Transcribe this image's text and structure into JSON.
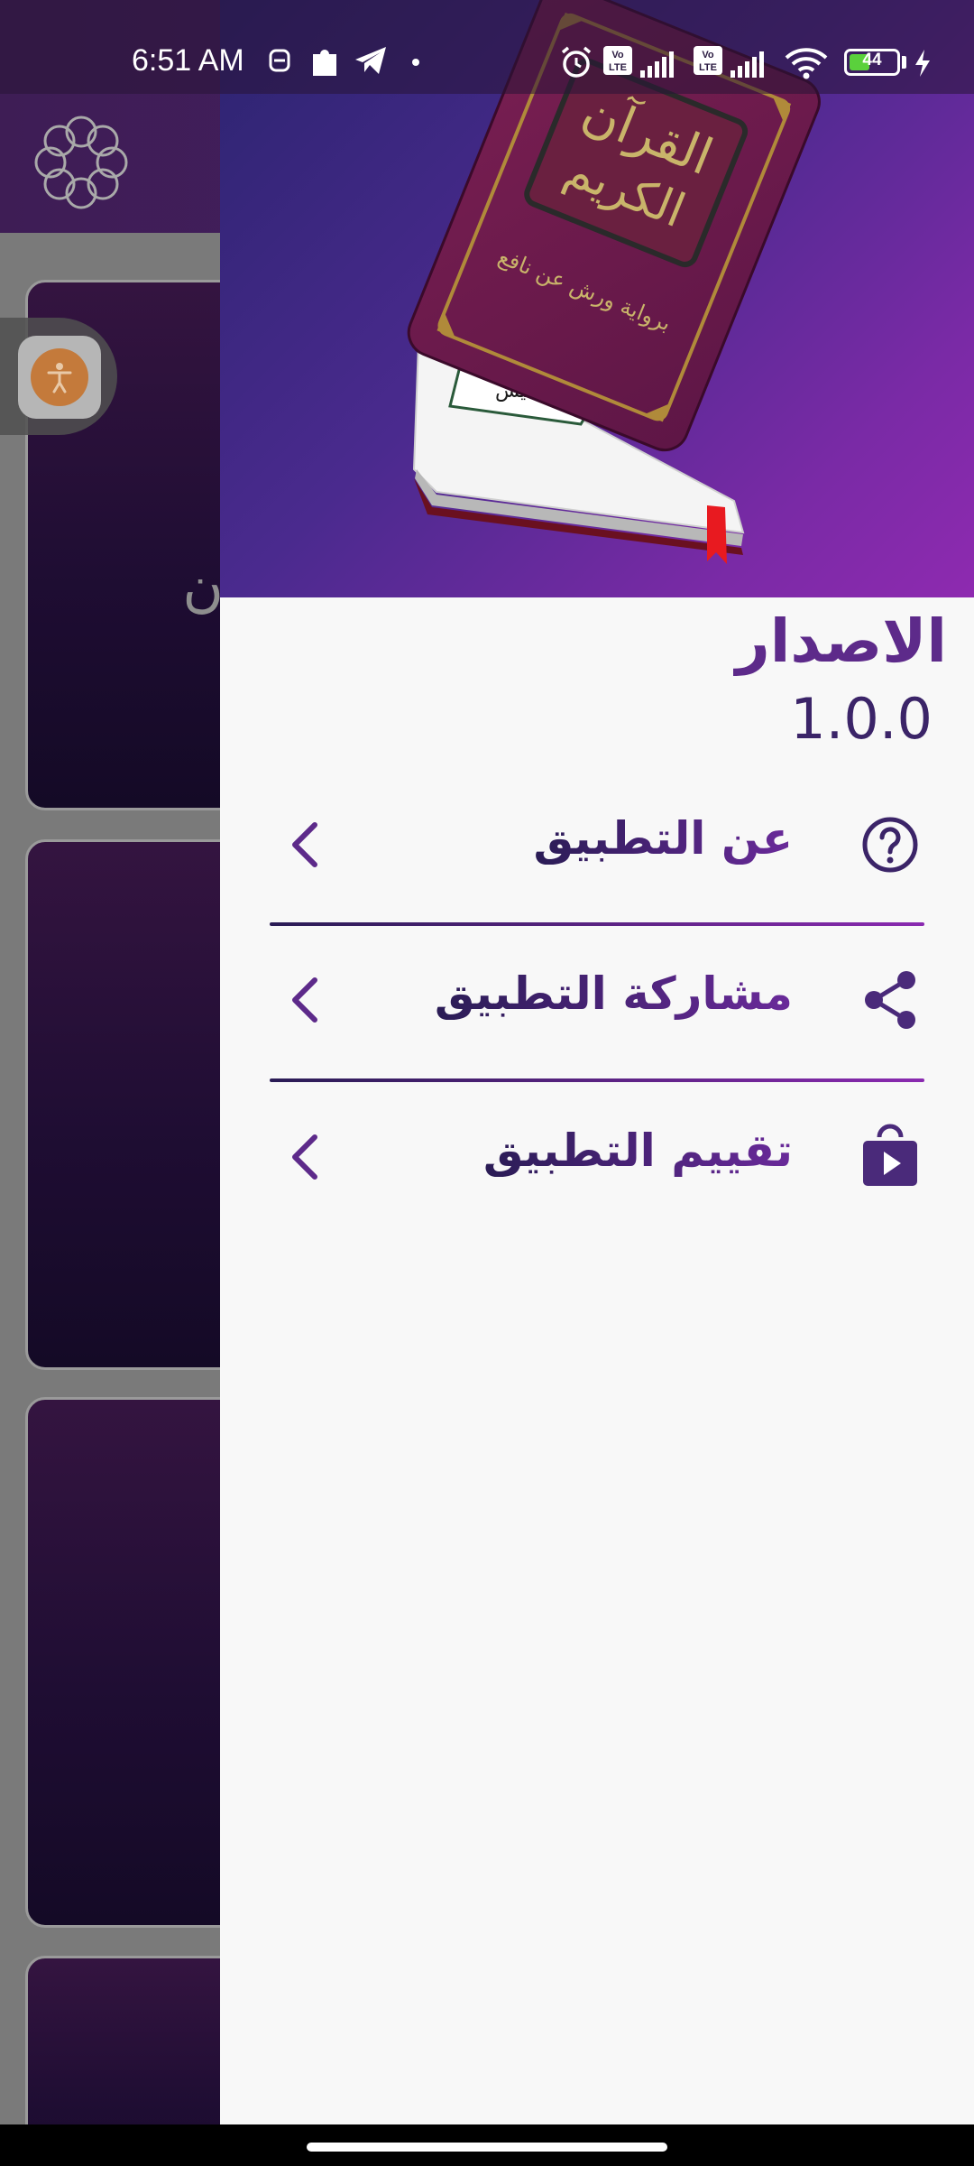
{
  "status_bar": {
    "time": "6:51 AM",
    "battery_level": "44",
    "battery_fraction": 0.44,
    "icons": [
      "notification-icon",
      "puzzle-icon",
      "telegram-icon",
      "dot-icon",
      "alarm-icon",
      "volte-icon",
      "signal-icon",
      "volte-icon",
      "signal-icon",
      "wifi-icon",
      "battery-icon",
      "charging-icon"
    ]
  },
  "background_app": {
    "card_title_partial": "قرآن"
  },
  "drawer": {
    "header_image": "quran-book-image",
    "book_title_line1": "القرآن",
    "book_title_line2": "الكريم",
    "book_subtitle": "برواية ورش عن نافع",
    "version_label": "الاصدار",
    "version_value": "1.0.0",
    "menu": [
      {
        "label": "عن التطبيق",
        "icon": "help-circle-icon"
      },
      {
        "label": "مشاركة التطبيق",
        "icon": "share-icon"
      },
      {
        "label": "تقييم التطبيق",
        "icon": "play-store-icon"
      }
    ]
  },
  "colors": {
    "accent": "#5d2a8a",
    "header_start": "#2c2470",
    "header_end": "#8e2ab0",
    "drawer_bg": "#f8f8f8"
  }
}
